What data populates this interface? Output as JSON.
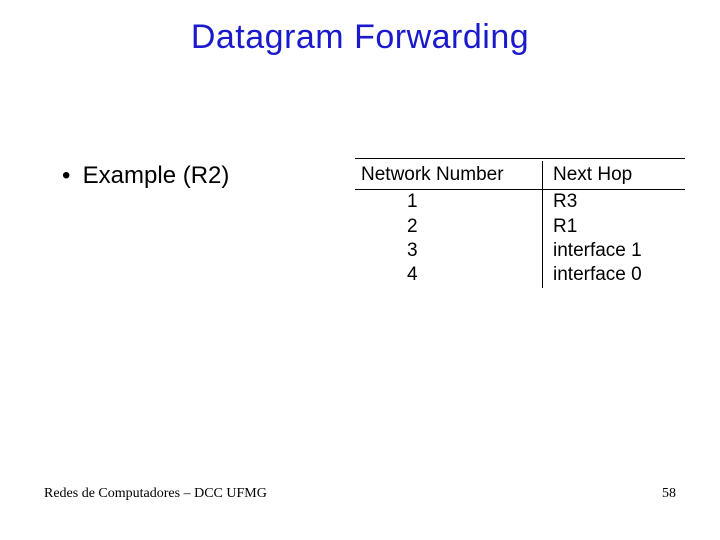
{
  "slide": {
    "title": "Datagram Forwarding",
    "bullet": "Example (R2)",
    "footer_left": "Redes de Computadores – DCC UFMG",
    "page_number": "58"
  },
  "table": {
    "headers": {
      "network_number": "Network Number",
      "next_hop": "Next Hop"
    },
    "rows": [
      {
        "network_number": "1",
        "next_hop": "R3"
      },
      {
        "network_number": "2",
        "next_hop": "R1"
      },
      {
        "network_number": "3",
        "next_hop": "interface 1"
      },
      {
        "network_number": "4",
        "next_hop": "interface 0"
      }
    ]
  }
}
